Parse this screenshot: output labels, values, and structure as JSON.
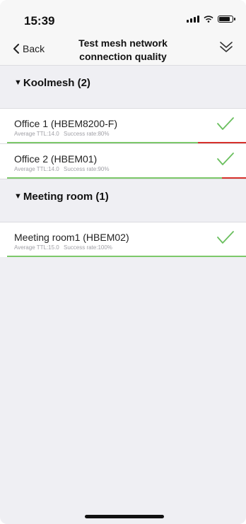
{
  "status": {
    "time": "15:39"
  },
  "nav": {
    "back_label": "Back",
    "title": "Test mesh network connection quality"
  },
  "groups": [
    {
      "label": "Koolmesh (2)",
      "devices": [
        {
          "name": "Office 1 (HBEM8200-F)",
          "ttl": "Average TTL:14.0",
          "success": "Success rate:80%",
          "success_fraction": 0.8
        },
        {
          "name": "Office 2 (HBEM01)",
          "ttl": "Average TTL:14.0",
          "success": "Success rate:90%",
          "success_fraction": 0.9
        }
      ]
    },
    {
      "label": "Meeting room (1)",
      "devices": [
        {
          "name": "Meeting room1 (HBEM02)",
          "ttl": "Average TTL:15.0",
          "success": "Success rate:100%",
          "success_fraction": 1.0
        }
      ]
    }
  ],
  "colors": {
    "good": "#7cc86a",
    "bad": "#d7302b",
    "check": "#6abf5e"
  },
  "icons": {
    "back": "chevron-left-icon",
    "expand": "double-chevron-down-icon",
    "check": "checkmark-icon"
  }
}
